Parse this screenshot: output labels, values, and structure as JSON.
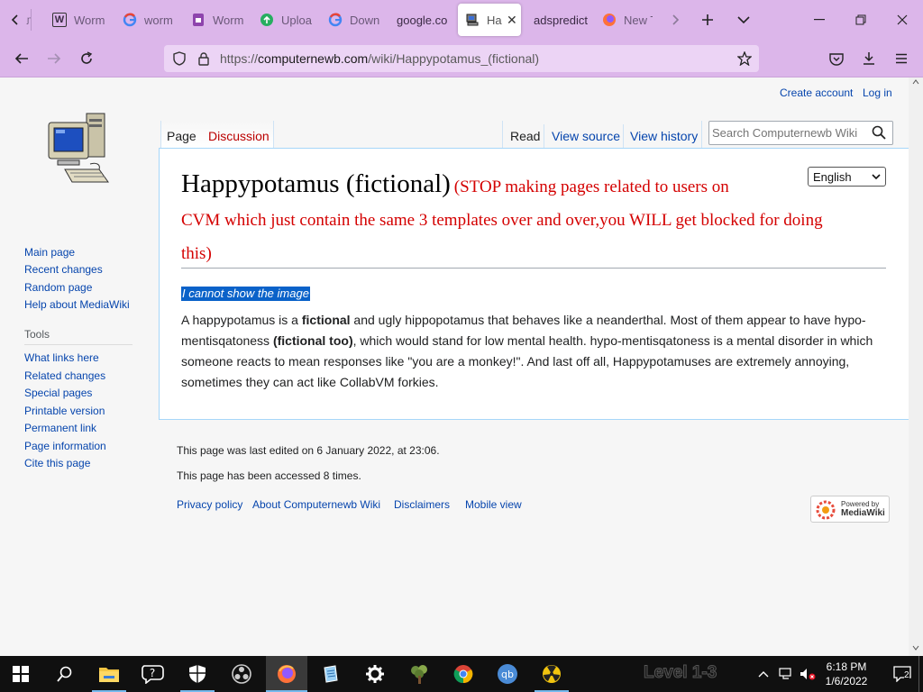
{
  "browser": {
    "tabs": [
      {
        "label": "Worm",
        "icon": "wikipedia-icon"
      },
      {
        "label": "worm",
        "icon": "google-icon"
      },
      {
        "label": "Worm",
        "icon": "page-icon"
      },
      {
        "label": "Uploa",
        "icon": "upload-icon"
      },
      {
        "label": "Down",
        "icon": "google-icon"
      },
      {
        "label": "google.co",
        "icon": "none"
      },
      {
        "label": "Ha",
        "icon": "computer-icon",
        "active": true
      },
      {
        "label": "adspredict",
        "icon": "none"
      },
      {
        "label": "New T",
        "icon": "firefox-icon"
      }
    ],
    "url_prefix": "https://",
    "url_domain": "computernewb.com",
    "url_path": "/wiki/Happypotamus_(fictional)"
  },
  "wiki": {
    "personal": {
      "create_account": "Create account",
      "log_in": "Log in"
    },
    "tabs": {
      "page": "Page",
      "discussion": "Discussion",
      "read": "Read",
      "view_source": "View source",
      "view_history": "View history"
    },
    "search_placeholder": "Search Computernewb Wiki",
    "language": "English",
    "title": "Happypotamus (fictional)",
    "warning_line1": "(STOP making pages related to users on",
    "warning_line2": "CVM which just contain the same 3 templates over and over,you WILL get blocked for doing",
    "warning_line3": "this)",
    "image_alt": "I cannot show the image",
    "body": {
      "p1": "A happypotamus is a ",
      "b1": "fictional",
      "p2": " and ugly hippopotamus that behaves like a neanderthal. Most of them appear to have hypo-mentisqatoness ",
      "b2": "(fictional too)",
      "p3": ", which would stand for low mental health. hypo-mentisqatoness is a mental disorder in which someone reacts to mean responses like \"you are a monkey!\". And last off all, Happypotamuses are extremely annoying, sometimes they can act like CollabVM forkies."
    },
    "sidebar": {
      "nav": [
        "Main page",
        "Recent changes",
        "Random page",
        "Help about MediaWiki"
      ],
      "tools_heading": "Tools",
      "tools": [
        "What links here",
        "Related changes",
        "Special pages",
        "Printable version",
        "Permanent link",
        "Page information",
        "Cite this page"
      ]
    },
    "footer": {
      "last_edited": "This page was last edited on 6 January 2022, at 23:06.",
      "accessed": "This page has been accessed 8 times.",
      "links": [
        "Privacy policy",
        "About Computernewb Wiki",
        "Disclaimers",
        "Mobile view"
      ],
      "powered_small": "Powered by",
      "powered_big": "MediaWiki"
    }
  },
  "taskbar": {
    "time": "6:18 PM",
    "date": "1/6/2022",
    "notification_count": "2",
    "watermark": "Level 1-3"
  },
  "colors": {
    "chrome": "#dcb6ea",
    "link": "#0645ad",
    "redlink": "#ba0000",
    "warning": "#d40000",
    "selection": "#0a62c9"
  }
}
